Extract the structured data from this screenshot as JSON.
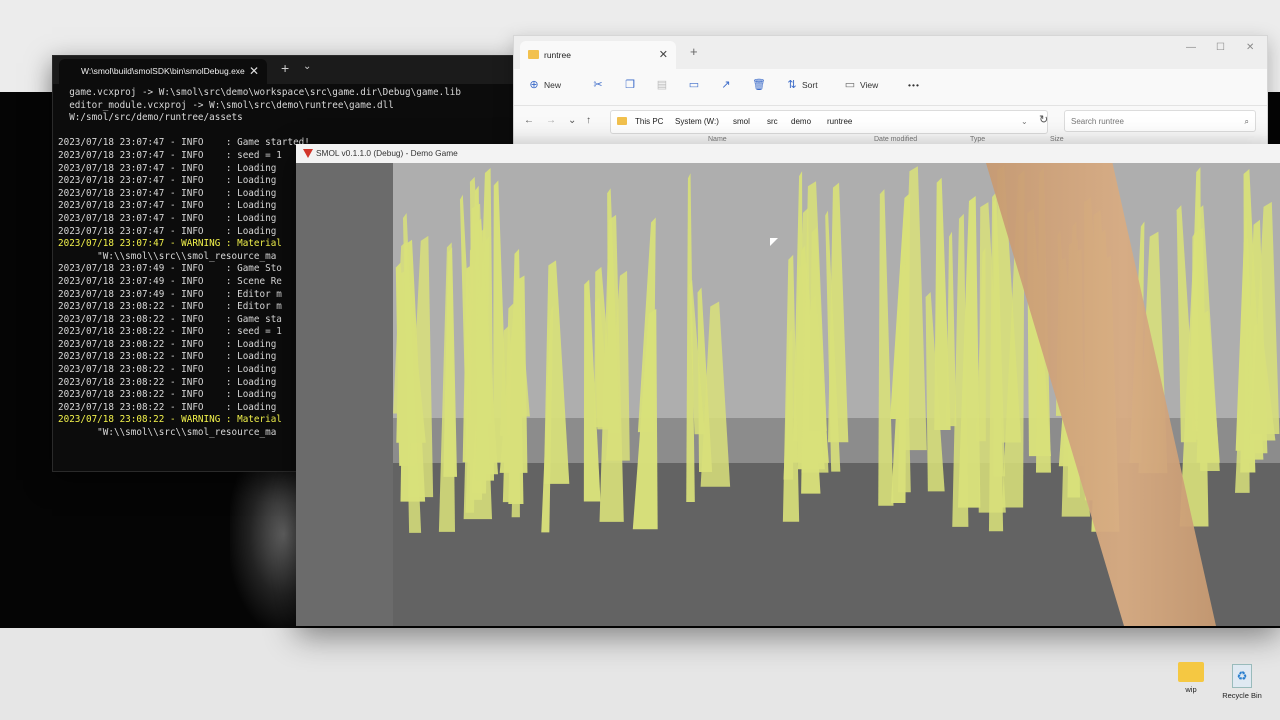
{
  "terminal": {
    "tab_title": "W:\\smol\\build\\smolSDK\\bin\\smolDebug.exe",
    "tab_close": "✕",
    "new_tab": "+",
    "dropdown": "⌄",
    "lines": [
      {
        "text": "  game.vcxproj -> W:\\smol\\src\\demo\\workspace\\src\\game.dir\\Debug\\game.lib",
        "warn": false
      },
      {
        "text": "  editor_module.vcxproj -> W:\\smol\\src\\demo\\runtree\\game.dll",
        "warn": false
      },
      {
        "text": "  W:/smol/src/demo/runtree/assets",
        "warn": false
      },
      {
        "text": "",
        "warn": false
      },
      {
        "text": "2023/07/18 23:07:47 - INFO    : Game started!",
        "warn": false
      },
      {
        "text": "2023/07/18 23:07:47 - INFO    : seed = 1",
        "warn": false
      },
      {
        "text": "2023/07/18 23:07:47 - INFO    : Loading",
        "warn": false
      },
      {
        "text": "2023/07/18 23:07:47 - INFO    : Loading",
        "warn": false
      },
      {
        "text": "2023/07/18 23:07:47 - INFO    : Loading",
        "warn": false
      },
      {
        "text": "2023/07/18 23:07:47 - INFO    : Loading",
        "warn": false
      },
      {
        "text": "2023/07/18 23:07:47 - INFO    : Loading",
        "warn": false
      },
      {
        "text": "2023/07/18 23:07:47 - INFO    : Loading",
        "warn": false
      },
      {
        "text": "2023/07/18 23:07:47 - WARNING : Material",
        "warn": true
      },
      {
        "text": "       \"W:\\\\smol\\\\src\\\\smol_resource_ma",
        "warn": false
      },
      {
        "text": "2023/07/18 23:07:49 - INFO    : Game Sto",
        "warn": false
      },
      {
        "text": "2023/07/18 23:07:49 - INFO    : Scene Re",
        "warn": false
      },
      {
        "text": "2023/07/18 23:07:49 - INFO    : Editor m",
        "warn": false
      },
      {
        "text": "2023/07/18 23:08:22 - INFO    : Editor m",
        "warn": false
      },
      {
        "text": "2023/07/18 23:08:22 - INFO    : Game sta",
        "warn": false
      },
      {
        "text": "2023/07/18 23:08:22 - INFO    : seed = 1",
        "warn": false
      },
      {
        "text": "2023/07/18 23:08:22 - INFO    : Loading",
        "warn": false
      },
      {
        "text": "2023/07/18 23:08:22 - INFO    : Loading",
        "warn": false
      },
      {
        "text": "2023/07/18 23:08:22 - INFO    : Loading",
        "warn": false
      },
      {
        "text": "2023/07/18 23:08:22 - INFO    : Loading",
        "warn": false
      },
      {
        "text": "2023/07/18 23:08:22 - INFO    : Loading",
        "warn": false
      },
      {
        "text": "2023/07/18 23:08:22 - INFO    : Loading",
        "warn": false
      },
      {
        "text": "2023/07/18 23:08:22 - WARNING : Material",
        "warn": true
      },
      {
        "text": "       \"W:\\\\smol\\\\src\\\\smol_resource_ma",
        "warn": false
      }
    ]
  },
  "explorer": {
    "tab_title": "runtree",
    "tab_close": "✕",
    "new_tab": "+",
    "window_controls": {
      "minimize": "—",
      "maximize": "☐",
      "close": "✕"
    },
    "toolbar": {
      "new_label": "New",
      "sort_label": "Sort",
      "view_label": "View",
      "more": "•••"
    },
    "breadcrumbs": [
      "This PC",
      "System (W:)",
      "smol",
      "src",
      "demo",
      "runtree"
    ],
    "search_placeholder": "Search runtree",
    "columns": [
      "Name",
      "Date modified",
      "Type",
      "Size"
    ]
  },
  "game": {
    "title": "SMOL v0.1.1.0 (Debug) - Demo Game",
    "colors": {
      "grass": "#d8e07a",
      "arm": "#d2a57d",
      "sky": "#aeaeae"
    }
  },
  "desktop": {
    "icons": [
      {
        "label": "wip",
        "icon": "folder-icon"
      },
      {
        "label": "Recycle Bin",
        "icon": "recycle-bin-icon"
      }
    ]
  }
}
